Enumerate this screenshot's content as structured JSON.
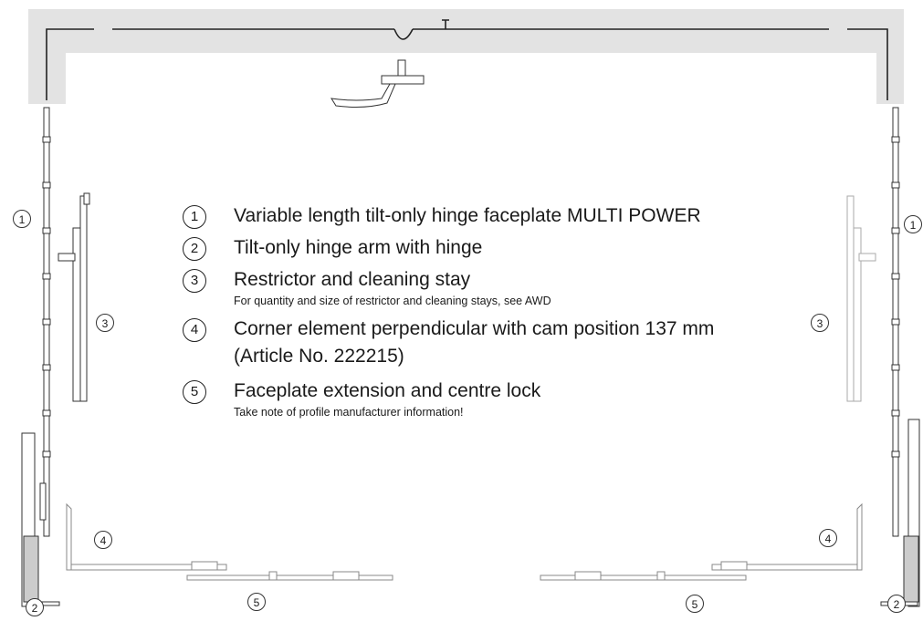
{
  "callout_labels": {
    "left_1": "1",
    "right_1": "1",
    "left_2": "2",
    "right_2": "2",
    "left_3": "3",
    "right_3": "3",
    "left_4": "4",
    "right_4": "4",
    "left_5": "5",
    "right_5": "5"
  },
  "legend": [
    {
      "number": "1",
      "title": "Variable length tilt-only hinge faceplate MULTI POWER",
      "note": ""
    },
    {
      "number": "2",
      "title": "Tilt-only hinge arm with hinge",
      "note": ""
    },
    {
      "number": "3",
      "title": "Restrictor and cleaning stay",
      "note": "For quantity and size of restrictor and cleaning stays, see AWD"
    },
    {
      "number": "4",
      "title": "Corner element perpendicular with cam position 137 mm",
      "title2": "(Article No. 222215)",
      "note": ""
    },
    {
      "number": "5",
      "title": "Faceplate extension and centre lock",
      "note": "Take note of profile manufacturer information!"
    }
  ],
  "colors": {
    "frame_fill": "#e3e3e3",
    "line": "#333333",
    "hardware_light": "#aaaaaa"
  }
}
